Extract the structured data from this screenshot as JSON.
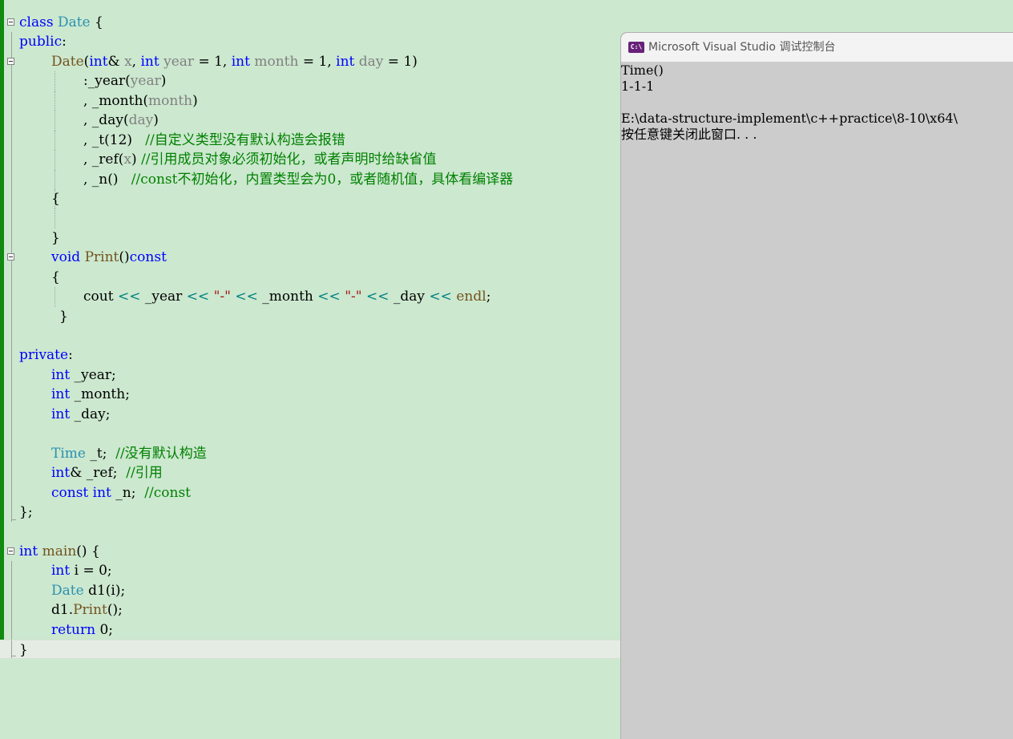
{
  "editor": {
    "lines": [
      {
        "fold": true,
        "indent": 0,
        "tokens": [
          [
            "kw",
            "class"
          ],
          [
            "plain",
            " "
          ],
          [
            "type",
            "Date"
          ],
          [
            "plain",
            " {"
          ]
        ]
      },
      {
        "indent": 0,
        "tokens": [
          [
            "kw",
            "public"
          ],
          [
            "plain",
            ":"
          ]
        ]
      },
      {
        "fold": true,
        "indent": 4,
        "tokens": [
          [
            "fn",
            "Date"
          ],
          [
            "plain",
            "("
          ],
          [
            "kw",
            "int"
          ],
          [
            "plain",
            "& "
          ],
          [
            "param",
            "x"
          ],
          [
            "plain",
            ", "
          ],
          [
            "kw",
            "int"
          ],
          [
            "plain",
            " "
          ],
          [
            "param",
            "year"
          ],
          [
            "plain",
            " = 1, "
          ],
          [
            "kw",
            "int"
          ],
          [
            "plain",
            " "
          ],
          [
            "param",
            "month"
          ],
          [
            "plain",
            " = 1, "
          ],
          [
            "kw",
            "int"
          ],
          [
            "plain",
            " "
          ],
          [
            "param",
            "day"
          ],
          [
            "plain",
            " = 1)"
          ]
        ]
      },
      {
        "indent": 8,
        "tokens": [
          [
            "plain",
            ":_year"
          ],
          [
            "plain",
            "("
          ],
          [
            "param",
            "year"
          ],
          [
            "plain",
            ")"
          ]
        ]
      },
      {
        "indent": 8,
        "tokens": [
          [
            "plain",
            ", _month"
          ],
          [
            "plain",
            "("
          ],
          [
            "param",
            "month"
          ],
          [
            "plain",
            ")"
          ]
        ]
      },
      {
        "indent": 8,
        "tokens": [
          [
            "plain",
            ", _day"
          ],
          [
            "plain",
            "("
          ],
          [
            "param",
            "day"
          ],
          [
            "plain",
            ")"
          ]
        ]
      },
      {
        "indent": 8,
        "tokens": [
          [
            "plain",
            ", _t(12)   "
          ],
          [
            "cmt",
            "//自定义类型没有默认构造会报错"
          ]
        ]
      },
      {
        "indent": 8,
        "tokens": [
          [
            "plain",
            ", _ref"
          ],
          [
            "plain",
            "("
          ],
          [
            "param",
            "x"
          ],
          [
            "plain",
            ") "
          ],
          [
            "cmt",
            "//引用成员对象必须初始化，或者声明时给缺省值"
          ]
        ]
      },
      {
        "indent": 8,
        "tokens": [
          [
            "plain",
            ", _n()   "
          ],
          [
            "cmt",
            "//const不初始化，内置类型会为0，或者随机值，具体看编译器"
          ]
        ]
      },
      {
        "indent": 4,
        "tokens": [
          [
            "plain",
            "{"
          ]
        ]
      },
      {
        "indent": 0,
        "tokens": []
      },
      {
        "indent": 4,
        "tokens": [
          [
            "plain",
            "}"
          ]
        ]
      },
      {
        "fold": true,
        "indent": 4,
        "tokens": [
          [
            "kw",
            "void"
          ],
          [
            "plain",
            " "
          ],
          [
            "fn",
            "Print"
          ],
          [
            "plain",
            "()"
          ],
          [
            "kw",
            "const"
          ]
        ]
      },
      {
        "indent": 4,
        "tokens": [
          [
            "plain",
            "{"
          ]
        ]
      },
      {
        "indent": 8,
        "tokens": [
          [
            "plain",
            "cout "
          ],
          [
            "op",
            "<<"
          ],
          [
            "plain",
            " _year "
          ],
          [
            "op",
            "<<"
          ],
          [
            "plain",
            " "
          ],
          [
            "str",
            "\"-\""
          ],
          [
            "plain",
            " "
          ],
          [
            "op",
            "<<"
          ],
          [
            "plain",
            " _month "
          ],
          [
            "op",
            "<<"
          ],
          [
            "plain",
            " "
          ],
          [
            "str",
            "\"-\""
          ],
          [
            "plain",
            " "
          ],
          [
            "op",
            "<<"
          ],
          [
            "plain",
            " _day "
          ],
          [
            "op",
            "<<"
          ],
          [
            "plain",
            " "
          ],
          [
            "fn",
            "endl"
          ],
          [
            "plain",
            ";"
          ]
        ]
      },
      {
        "indent": 5,
        "tokens": [
          [
            "plain",
            "}"
          ]
        ]
      },
      {
        "indent": 0,
        "tokens": []
      },
      {
        "indent": 0,
        "tokens": [
          [
            "kw",
            "private"
          ],
          [
            "plain",
            ":"
          ]
        ]
      },
      {
        "indent": 4,
        "tokens": [
          [
            "kw",
            "int"
          ],
          [
            "plain",
            " _year;"
          ]
        ]
      },
      {
        "indent": 4,
        "tokens": [
          [
            "kw",
            "int"
          ],
          [
            "plain",
            " _month;"
          ]
        ]
      },
      {
        "indent": 4,
        "tokens": [
          [
            "kw",
            "int"
          ],
          [
            "plain",
            " _day;"
          ]
        ]
      },
      {
        "indent": 0,
        "tokens": []
      },
      {
        "indent": 4,
        "tokens": [
          [
            "type",
            "Time"
          ],
          [
            "plain",
            " _t;  "
          ],
          [
            "cmt",
            "//没有默认构造"
          ]
        ]
      },
      {
        "indent": 4,
        "tokens": [
          [
            "kw",
            "int"
          ],
          [
            "plain",
            "& _ref;  "
          ],
          [
            "cmt",
            "//引用"
          ]
        ]
      },
      {
        "indent": 4,
        "tokens": [
          [
            "kw",
            "const"
          ],
          [
            "plain",
            " "
          ],
          [
            "kw",
            "int"
          ],
          [
            "plain",
            " _n;  "
          ],
          [
            "cmt",
            "//const"
          ]
        ]
      },
      {
        "indent": 0,
        "tokens": [
          [
            "plain",
            "};"
          ]
        ]
      },
      {
        "indent": 0,
        "tokens": []
      },
      {
        "fold": true,
        "indent": 0,
        "tokens": [
          [
            "kw",
            "int"
          ],
          [
            "plain",
            " "
          ],
          [
            "fn",
            "main"
          ],
          [
            "plain",
            "() {"
          ]
        ]
      },
      {
        "indent": 4,
        "tokens": [
          [
            "kw",
            "int"
          ],
          [
            "plain",
            " i = 0;"
          ]
        ]
      },
      {
        "indent": 4,
        "tokens": [
          [
            "type",
            "Date"
          ],
          [
            "plain",
            " d1(i);"
          ]
        ]
      },
      {
        "indent": 4,
        "tokens": [
          [
            "plain",
            "d1."
          ],
          [
            "fn",
            "Print"
          ],
          [
            "plain",
            "();"
          ]
        ]
      },
      {
        "indent": 4,
        "tokens": [
          [
            "kw",
            "return"
          ],
          [
            "plain",
            " 0;"
          ]
        ]
      },
      {
        "indent": 0,
        "current": true,
        "tokens": [
          [
            "plain",
            "}"
          ]
        ]
      }
    ]
  },
  "console": {
    "icon_label": "C:\\",
    "title": "Microsoft Visual Studio 调试控制台",
    "output": [
      "Time()",
      "1-1-1",
      "",
      "E:\\data-structure-implement\\c++practice\\8-10\\x64\\",
      "按任意键关闭此窗口. . ."
    ]
  }
}
